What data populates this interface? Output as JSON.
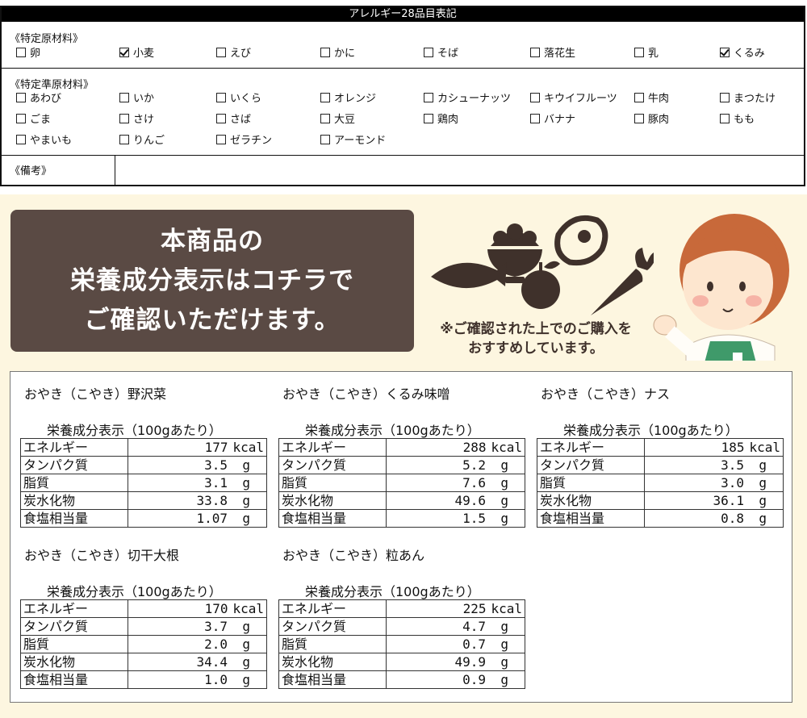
{
  "allergen": {
    "title": "アレルギー28品目表記",
    "specified_label": "《特定原材料》",
    "specified_items": [
      {
        "label": "卵",
        "checked": false
      },
      {
        "label": "小麦",
        "checked": true
      },
      {
        "label": "えび",
        "checked": false
      },
      {
        "label": "かに",
        "checked": false
      },
      {
        "label": "そば",
        "checked": false
      },
      {
        "label": "落花生",
        "checked": false
      },
      {
        "label": "乳",
        "checked": false
      },
      {
        "label": "くるみ",
        "checked": true
      }
    ],
    "semi_label": "《特定準原材料》",
    "semi_items": [
      {
        "label": "あわび",
        "checked": false
      },
      {
        "label": "いか",
        "checked": false
      },
      {
        "label": "いくら",
        "checked": false
      },
      {
        "label": "オレンジ",
        "checked": false
      },
      {
        "label": "カシューナッツ",
        "checked": false
      },
      {
        "label": "キウイフルーツ",
        "checked": false
      },
      {
        "label": "牛肉",
        "checked": false
      },
      {
        "label": "まつたけ",
        "checked": false
      },
      {
        "label": "ごま",
        "checked": false
      },
      {
        "label": "さけ",
        "checked": false
      },
      {
        "label": "さば",
        "checked": false
      },
      {
        "label": "大豆",
        "checked": false
      },
      {
        "label": "鶏肉",
        "checked": false
      },
      {
        "label": "バナナ",
        "checked": false
      },
      {
        "label": "豚肉",
        "checked": false
      },
      {
        "label": "もも",
        "checked": false
      },
      {
        "label": "やまいも",
        "checked": false
      },
      {
        "label": "りんご",
        "checked": false
      },
      {
        "label": "ゼラチン",
        "checked": false
      },
      {
        "label": "アーモンド",
        "checked": false
      }
    ],
    "notes_label": "《備考》",
    "notes_value": ""
  },
  "banner": {
    "heading_lines": [
      "本商品の",
      "栄養成分表示はコチラで",
      "ご確認いただけます。"
    ],
    "note_lines": [
      "※ご確認された上でのご購入を",
      "おすすめしています。"
    ],
    "colors": {
      "box": "#5a4a44",
      "background": "#fdf6e0",
      "icons": "#3f312b"
    },
    "icons": [
      "rice-bowl-icon",
      "meat-icon",
      "fish-icon",
      "apple-icon",
      "carrot-icon"
    ]
  },
  "nutrition": {
    "table_title": "栄養成分表示（100gあたり）",
    "row_labels": [
      "エネルギー",
      "タンパク質",
      "脂質",
      "炭水化物",
      "食塩相当量"
    ],
    "products": [
      {
        "name": "おやき（こやき）野沢菜",
        "values": [
          "177",
          "3.5",
          "3.1",
          "33.8",
          "1.07"
        ],
        "units": [
          "kcal",
          "g",
          "g",
          "g",
          "g"
        ]
      },
      {
        "name": "おやき（こやき）くるみ味噌",
        "values": [
          "288",
          "5.2",
          "7.6",
          "49.6",
          "1.5"
        ],
        "units": [
          "kcal",
          "g",
          "g",
          "g",
          "g"
        ]
      },
      {
        "name": "おやき（こやき）ナス",
        "values": [
          "185",
          "3.5",
          "3.0",
          "36.1",
          "0.8"
        ],
        "units": [
          "kcal",
          "g",
          "g",
          "g",
          "g"
        ]
      },
      {
        "name": "おやき（こやき）切干大根",
        "values": [
          "170",
          "3.7",
          "2.0",
          "34.4",
          "1.0"
        ],
        "units": [
          "kcal",
          "g",
          "g",
          "g",
          "g"
        ]
      },
      {
        "name": "おやき（こやき）粒あん",
        "values": [
          "225",
          "4.7",
          "0.7",
          "49.9",
          "0.9"
        ],
        "units": [
          "kcal",
          "g",
          "g",
          "g",
          "g"
        ]
      }
    ]
  }
}
